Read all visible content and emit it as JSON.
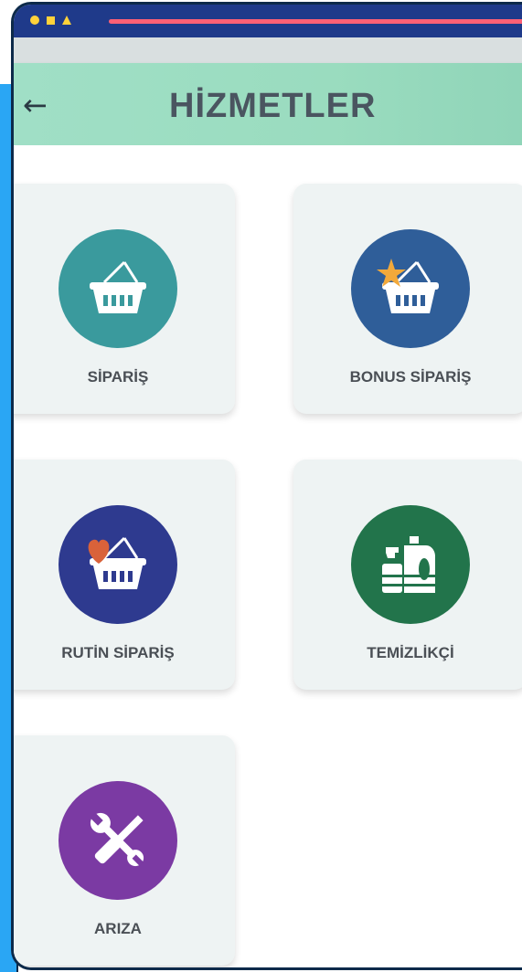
{
  "header": {
    "back_icon": "arrow-left-icon",
    "title": "HİZMETLER"
  },
  "services": [
    {
      "label": "SİPARİŞ",
      "icon": "basket-icon",
      "color": "#3a9a9d"
    },
    {
      "label": "BONUS SİPARİŞ",
      "icon": "basket-star-icon",
      "color": "#2f5e99"
    },
    {
      "label": "RUTİN SİPARİŞ",
      "icon": "basket-heart-icon",
      "color": "#2e3a8f"
    },
    {
      "label": "TEMİZLİKÇİ",
      "icon": "cleaning-supplies-icon",
      "color": "#22744b"
    },
    {
      "label": "ARIZA",
      "icon": "tools-icon",
      "color": "#7b3aa3"
    }
  ]
}
